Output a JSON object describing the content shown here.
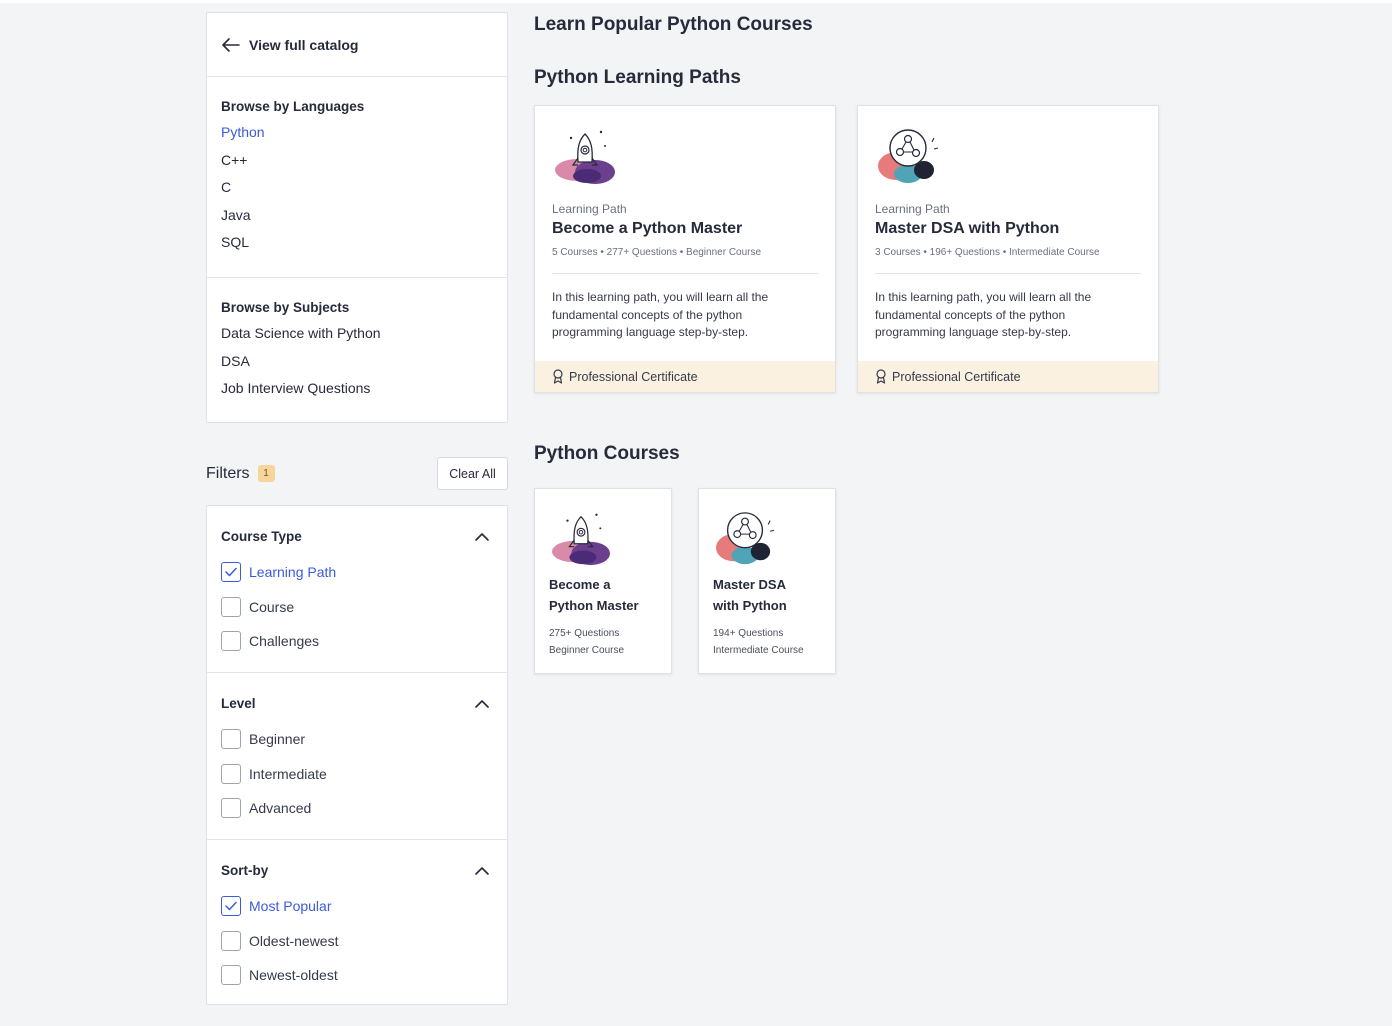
{
  "sidebar": {
    "view_catalog": "View full catalog",
    "languages": {
      "title": "Browse by Languages",
      "items": [
        "Python",
        "C++",
        "C",
        "Java",
        "SQL"
      ]
    },
    "subjects": {
      "title": "Browse by Subjects",
      "items": [
        "Data Science with Python",
        "DSA",
        "Job Interview Questions"
      ]
    },
    "filters": {
      "title": "Filters",
      "badge": "1",
      "clear_label": "Clear All",
      "groups": [
        {
          "title": "Course Type",
          "options": [
            "Learning Path",
            "Course",
            "Challenges"
          ]
        },
        {
          "title": "Level",
          "options": [
            "Beginner",
            "Intermediate",
            "Advanced"
          ]
        },
        {
          "title": "Sort-by",
          "options": [
            "Most Popular",
            "Oldest-newest",
            "Newest-oldest"
          ]
        }
      ]
    }
  },
  "main": {
    "page_title": "Learn Popular Python Courses",
    "paths_title": "Python Learning Paths",
    "paths": [
      {
        "kind": "Learning Path",
        "name": "Become a Python Master",
        "meta": "5 Courses  •  277+ Questions  •  Beginner Course",
        "desc": "In this learning path, you will learn all the fundamental concepts of the python programming language step-by-step.",
        "cert": "Professional Certificate"
      },
      {
        "kind": "Learning Path",
        "name": "Master DSA with Python",
        "meta": "3 Courses  •  196+ Questions  •  Intermediate Course",
        "desc": "In this learning path, you will learn all the fundamental concepts of the python programming language step-by-step.",
        "cert": "Professional Certificate"
      }
    ],
    "courses_title": "Python Courses",
    "courses": [
      {
        "name_l1": "Become a",
        "name_l2": "Python Master",
        "questions": "275+ Questions",
        "level": "Beginner Course"
      },
      {
        "name_l1": "Master DSA",
        "name_l2": "with Python",
        "questions": "194+ Questions",
        "level": "Intermediate Course"
      }
    ]
  },
  "colors": {
    "accent": "#3b5bdb",
    "cert_bg": "#fbf1e0",
    "badge_bg": "#f6d59b"
  },
  "icons": [
    "arrow-left-icon",
    "chevron-up-icon",
    "checkmark-icon",
    "ribbon-icon",
    "rocket-illustration",
    "graph-illustration"
  ]
}
